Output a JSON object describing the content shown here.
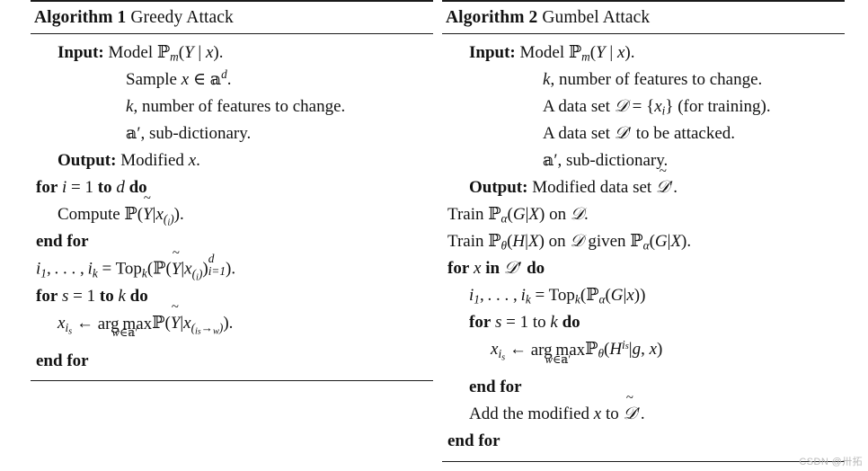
{
  "document": {
    "type": "algorithm-pseudocode-figure",
    "watermark": "CSDN @卅拓",
    "background_color": "#ffffff",
    "text_color": "#111111"
  },
  "algorithms": [
    {
      "id": "algorithm-1",
      "label": "Algorithm 1",
      "name": "Greedy Attack",
      "lines": [
        {
          "id": "l1",
          "indent": 0,
          "text": "Input:  Model P_m(Y | x)."
        },
        {
          "id": "l2",
          "indent": "hang",
          "text": "Sample x ∈ W^d."
        },
        {
          "id": "l3",
          "indent": "hang",
          "text": "k, number of features to change."
        },
        {
          "id": "l4",
          "indent": "hang",
          "text": "W′, sub-dictionary."
        },
        {
          "id": "l5",
          "indent": 0,
          "text": "Output: Modified x."
        },
        {
          "id": "l6",
          "indent": 0,
          "text": "for i = 1 to d do"
        },
        {
          "id": "l7",
          "indent": 1,
          "text": "Compute P(Ỹ|x_(i))."
        },
        {
          "id": "l8",
          "indent": 0,
          "text": "end for"
        },
        {
          "id": "l9",
          "indent": 0,
          "text": "i_1, …, i_k = Top_k(P(Ỹ|x_(i))_{i=1}^{d})."
        },
        {
          "id": "l10",
          "indent": 0,
          "text": "for s = 1 to k do"
        },
        {
          "id": "l11",
          "indent": 1,
          "text": "x_{i_s} ← arg max_{w∈W′} P(Ỹ|x_{(i_s→w)})."
        },
        {
          "id": "l12",
          "indent": 0,
          "text": "end for"
        }
      ]
    },
    {
      "id": "algorithm-2",
      "label": "Algorithm 2",
      "name": "Gumbel Attack",
      "lines": [
        {
          "id": "r1",
          "indent": 0,
          "text": "Input:  Model P_m(Y | x)."
        },
        {
          "id": "r2",
          "indent": "hang",
          "text": "k, number of features to change."
        },
        {
          "id": "r3",
          "indent": "hang",
          "text": "A data set D = {x_i} (for training)."
        },
        {
          "id": "r4",
          "indent": "hang",
          "text": "A data set D′ to be attacked."
        },
        {
          "id": "r5",
          "indent": "hang",
          "text": "W′, sub-dictionary."
        },
        {
          "id": "r6",
          "indent": 0,
          "text": "Output: Modified data set D̃′."
        },
        {
          "id": "r7",
          "indent": 0,
          "text": "Train P_α(G|X) on D."
        },
        {
          "id": "r8",
          "indent": 0,
          "text": "Train P_θ(H|X) on D given P_α(G|X)."
        },
        {
          "id": "r9",
          "indent": 0,
          "text": "for x in D′ do"
        },
        {
          "id": "r10",
          "indent": 1,
          "text": "i_1, …, i_k = Top_k(P_α(G|x))"
        },
        {
          "id": "r11",
          "indent": 1,
          "text": "for s = 1 to k do"
        },
        {
          "id": "r12",
          "indent": 2,
          "text": "x_{i_s} ← arg max_{w∈W′} P_θ(H^{i_s}|g, x)"
        },
        {
          "id": "r13",
          "indent": 1,
          "text": "end for"
        },
        {
          "id": "r14",
          "indent": 1,
          "text": "Add the modified x to D̃′."
        },
        {
          "id": "r15",
          "indent": 0,
          "text": "end for"
        }
      ]
    }
  ],
  "keywords": {
    "input": "Input:",
    "output": "Output:",
    "for": "for",
    "end_for": "end for",
    "to": "to",
    "do": "do",
    "in": "in",
    "given": "given",
    "train": "Train",
    "compute": "Compute",
    "model": "Model",
    "sample": "Sample",
    "modified": "Modified",
    "data_set": "data set",
    "a_data_set": "A data set",
    "number_of_features": ", number of features to change.",
    "sub_dictionary": ", sub-dictionary.",
    "for_training": "(for training).",
    "to_be_attacked": "to be attacked.",
    "add_the_modified": "Add the modified",
    "arg": "arg",
    "max": "max",
    "top": "Top",
    "on": "on"
  }
}
